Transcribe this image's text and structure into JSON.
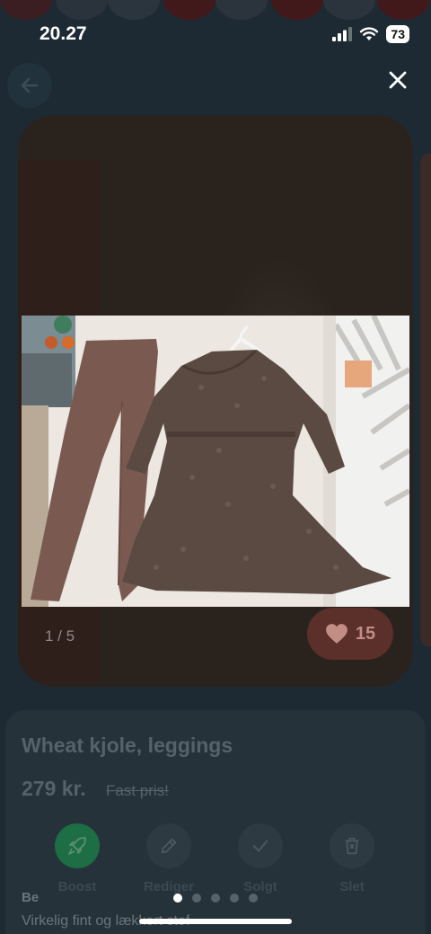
{
  "status_bar": {
    "time": "20.27",
    "battery": "73"
  },
  "gallery": {
    "counter": "1 / 5",
    "likes": "15"
  },
  "listing": {
    "title": "Wheat kjole, leggings",
    "price": "279 kr.",
    "price_type": "Fast pris!",
    "description_heading": "Be",
    "description": "Virkelig fint og lækkert stof"
  },
  "actions": [
    {
      "label": "Boost",
      "icon": "rocket-icon"
    },
    {
      "label": "Rediger",
      "icon": "pencil-icon"
    },
    {
      "label": "Solgt",
      "icon": "checkmark-icon"
    },
    {
      "label": "Slet",
      "icon": "trash-icon"
    }
  ],
  "pagination": {
    "total": 5,
    "active": 1
  },
  "colors": {
    "boost": "#1d6e44",
    "like": "#5b2f2a",
    "dress": "#5a4a42",
    "leggings": "#7a5a50"
  }
}
